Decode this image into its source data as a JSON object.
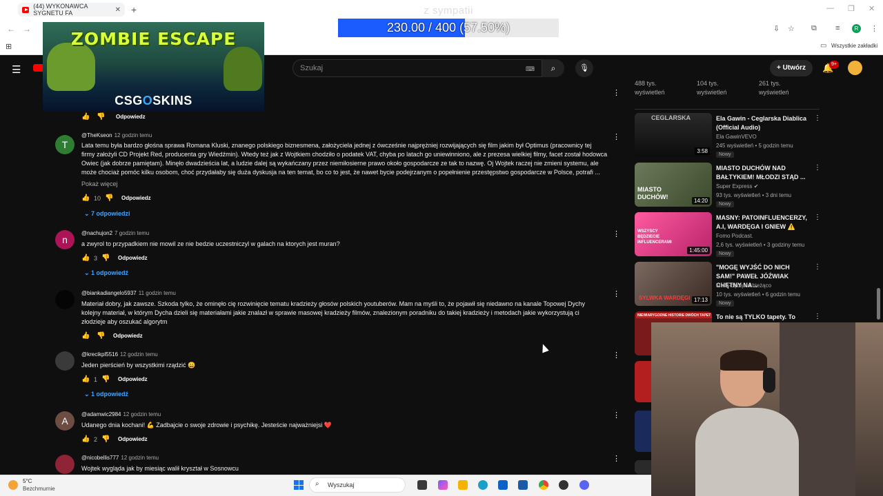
{
  "browser": {
    "tab_title": "(44) WYKONAWCA SYGNETU FA",
    "bookmarks_all": "Wszystkie zakładki",
    "profile_initial": "R"
  },
  "overlay": {
    "ad_game": "ZOMBIE ESCAPE",
    "ad_brand_a": "CSG",
    "ad_brand_o": "O",
    "ad_brand_b": "SKINS",
    "goal_title": "z sympatii",
    "goal_text": "230.00 / 400 (57.50%)",
    "goal_fraction": 0.575
  },
  "header": {
    "search_placeholder": "Szukaj",
    "create_label": "Utwórz",
    "notif_badge": "9+"
  },
  "top_reply": {
    "reply_label": "Odpowiedz"
  },
  "comments": [
    {
      "author": "@TheKseon",
      "time": "12 godzin temu",
      "avatar_letter": "T",
      "avatar_color": "#2e7d32",
      "text": "Lata temu była bardzo głośna sprawa Romana Kluski, znanego polskiego biznesmena, założyciela jednej z ówcześnie najprężniej rozwijających się film jakim był Optimus (pracownicy tej\nfirmy założyli CD Projekt Red, producenta gry Wiedźmin). Wtedy też jak z Wojtkiem chodziło o podatek VAT, chyba po latach go uniewinniono, ale z prezesa wielkiej filmy, facet został hodowca\nOwiec (jak dobrze pamiętam). Minęło dwadzieścia lat, a ludzie dalej są wykańczany przez niemiłosierne prawo około gospodarcze ze tak to nazwę. Oj Wojtek raczej nie zmieni systemu, ale\nmoże chociaż pomóc kilku osobom, choć przydałaby się duża dyskusja na ten temat, bo co to jest, że nawet bycie podejrzanym o popełnienie przestępstwo gospodarcze w Polsce, potrafi ...",
      "show_more": "Pokaż więcej",
      "likes": "10",
      "reply_label": "Odpowiedz",
      "replies": "7 odpowiedzi"
    },
    {
      "author": "@nachujon2",
      "time": "7 godzin temu",
      "avatar_letter": "n",
      "avatar_color": "#ad1457",
      "text": "a zwyrol to przypadkiem nie mowil ze nie bedzie uczestniczyl w galach na ktorych jest muran?",
      "likes": "3",
      "reply_label": "Odpowiedz",
      "replies": "1 odpowiedź"
    },
    {
      "author": "@biankadiangelo5937",
      "time": "11 godzin temu",
      "avatar_letter": "",
      "avatar_color": "#050505",
      "text": "Materiał dobry, jak zawsze. Szkoda tylko, że ominęło cię rozwinięcie tematu kradzieży głosów polskich youtuberów. Mam na myśli to, że pojawił się niedawno na kanale Topowej Dychy\nkolejny materiał, w którym Dycha dzieli się materiałami jakie znalazł w sprawie masowej kradzieży filmów, znalezionym poradniku do takiej kradzieży i metodach jakie wykorzystują ci\nzłodzieje aby oszukać algorytm",
      "likes": "",
      "reply_label": "Odpowiedz",
      "replies": ""
    },
    {
      "author": "@krecikpl5516",
      "time": "12 godzin temu",
      "avatar_letter": "",
      "avatar_color": "#3a3a3a",
      "text": "Jeden pierścień by wszystkimi rządzić 😄",
      "likes": "1",
      "reply_label": "Odpowiedz",
      "replies": "1 odpowiedź"
    },
    {
      "author": "@adamwic2984",
      "time": "12 godzin temu",
      "avatar_letter": "A",
      "avatar_color": "#6d4c41",
      "text": "Udanego dnia kochani! 💪 Zadbajcie o swoje zdrowie i psychikę. Jesteście najważniejsi ❤️",
      "likes": "2",
      "reply_label": "Odpowiedz",
      "replies": ""
    },
    {
      "author": "@nicobellis777",
      "time": "12 godzin temu",
      "avatar_letter": "",
      "avatar_color": "#8e2436",
      "text": "Wojtek wygląda jak by miesiąc walił kryształ w Sosnowcu",
      "likes": "",
      "reply_label": "",
      "replies": ""
    }
  ],
  "sidebar": {
    "stats": [
      {
        "count": "488 tys.",
        "label": "wyświetleń"
      },
      {
        "count": "104 tys.",
        "label": "wyświetleń"
      },
      {
        "count": "261 tys.",
        "label": "wyświetleń"
      }
    ],
    "videos": [
      {
        "title": "Ela Gawin - Ceglarska Diablica (Official Audio)",
        "channel": "Ela GawinVEVO",
        "meta": "245 wyświetleń • 5 godzin temu",
        "badge": "Nowy",
        "duration": "3:58",
        "thumb_text": "CEGLARSKA",
        "thumb_color": "#1a1a1a"
      },
      {
        "title": "MIASTO DUCHÓW NAD BAŁTYKIEM! MŁODZI STĄD ...",
        "channel": "Super Express",
        "meta": "93 tys. wyświetleń • 3 dni temu",
        "badge": "Nowy",
        "duration": "14:20",
        "thumb_text": "MIASTO DUCHÓW!",
        "thumb_color": "#4a5a3a"
      },
      {
        "title": "MASNY: PATOINFLUENCERZY, A.I, WARDĘGA I GNIEW ⚠️",
        "channel": "Fomo Podcast.",
        "meta": "2,6 tys. wyświetleń • 3 godziny temu",
        "badge": "Nowy",
        "duration": "1:45:00",
        "thumb_text": "WSZYSCY BĘDZIECIE INFLUENCERAMI",
        "thumb_color": "#e64a8a"
      },
      {
        "title": "\"MOGĘ WYJŚĆ DO NICH SAM!\" PAWEŁ JÓŹWIAK CHĘTNY NA...",
        "channel": "MMA-będą na bieżąco",
        "meta": "10 tys. wyświetleń • 6 godzin temu",
        "badge": "Nowy",
        "duration": "17:13",
        "thumb_text": "SYLWKA WARDĘGI",
        "thumb_color": "#5a4a40"
      },
      {
        "title": "To nie są TYLKO tapety. To dwie",
        "channel": "",
        "meta": "",
        "badge": "",
        "duration": "",
        "thumb_text": "NIEWIARYGODNE HISTORIE DWÓCH TAPET",
        "thumb_color": "#7a1a1a"
      }
    ]
  },
  "taskbar": {
    "temp": "5°C",
    "condition": "Bezchmurnie",
    "search": "Wyszukaj"
  }
}
